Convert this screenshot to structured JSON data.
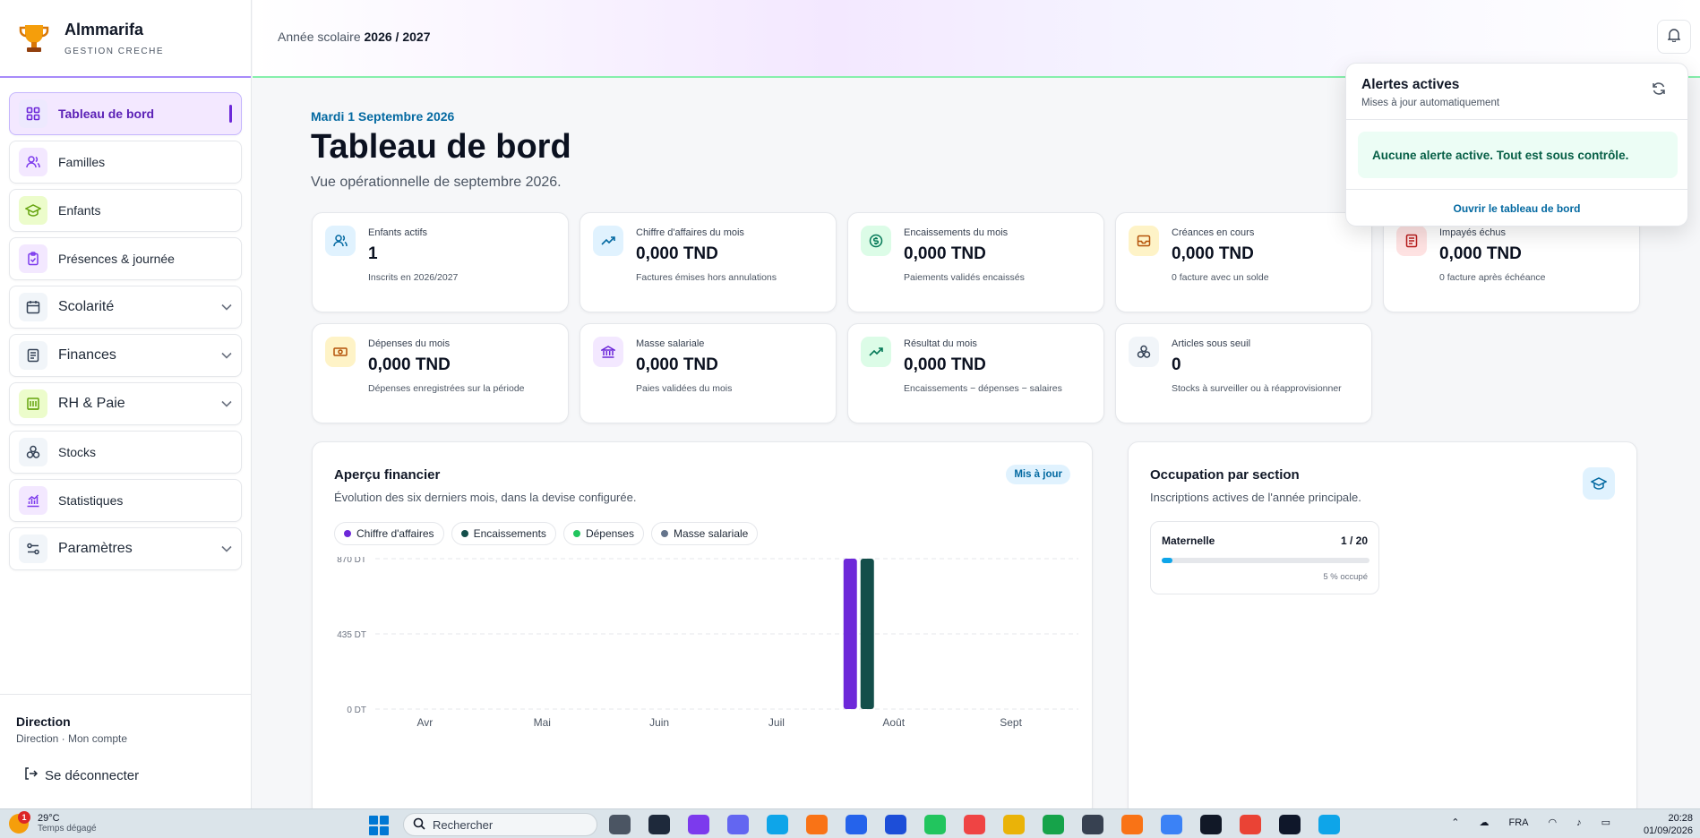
{
  "brand": {
    "name": "Almmarifa",
    "subtitle": "GESTION CRECHE"
  },
  "sidebar": {
    "items": [
      {
        "label": "Tableau de bord",
        "icon": "grid-icon",
        "active": true
      },
      {
        "label": "Familles",
        "icon": "users-icon"
      },
      {
        "label": "Enfants",
        "icon": "graduation-cap-icon"
      },
      {
        "label": "Présences & journée",
        "icon": "clipboard-check-icon"
      },
      {
        "label": "Scolarité",
        "icon": "calendar-icon",
        "expandable": true
      },
      {
        "label": "Finances",
        "icon": "receipt-icon",
        "expandable": true
      },
      {
        "label": "RH & Paie",
        "icon": "building-icon",
        "expandable": true
      },
      {
        "label": "Stocks",
        "icon": "boxes-icon"
      },
      {
        "label": "Statistiques",
        "icon": "bar-chart-icon"
      },
      {
        "label": "Paramètres",
        "icon": "sliders-icon",
        "expandable": true
      }
    ],
    "footer": {
      "role": "Direction",
      "account": "Direction · Mon compte",
      "logout": "Se déconnecter"
    }
  },
  "topbar": {
    "year_label": "Année scolaire",
    "year_value": "2026 / 2027"
  },
  "page": {
    "date": "Mardi 1 Septembre 2026",
    "title": "Tableau de bord",
    "subtitle": "Vue opérationnelle de septembre 2026."
  },
  "kpis": [
    {
      "label": "Enfants actifs",
      "value": "1",
      "caption": "Inscrits en 2026/2027",
      "icon": "users-icon"
    },
    {
      "label": "Chiffre d'affaires du mois",
      "value": "0,000 TND",
      "caption": "Factures émises hors annulations",
      "icon": "trending-up-icon"
    },
    {
      "label": "Encaissements du mois",
      "value": "0,000 TND",
      "caption": "Paiements validés encaissés",
      "icon": "dollar-circle-icon"
    },
    {
      "label": "Créances en cours",
      "value": "0,000 TND",
      "caption": "0 facture avec un solde",
      "icon": "inbox-icon"
    },
    {
      "label": "Impayés échus",
      "value": "0,000 TND",
      "caption": "0 facture après échéance",
      "icon": "document-icon"
    },
    {
      "label": "Dépenses du mois",
      "value": "0,000 TND",
      "caption": "Dépenses enregistrées sur la période",
      "icon": "banknote-icon"
    },
    {
      "label": "Masse salariale",
      "value": "0,000 TND",
      "caption": "Paies validées du mois",
      "icon": "bank-icon"
    },
    {
      "label": "Résultat du mois",
      "value": "0,000 TND",
      "caption": "Encaissements − dépenses − salaires",
      "icon": "trending-up-icon"
    },
    {
      "label": "Articles sous seuil",
      "value": "0",
      "caption": "Stocks à surveiller ou à réapprovisionner",
      "icon": "boxes-icon"
    }
  ],
  "finance_card": {
    "title": "Aperçu financier",
    "subtitle": "Évolution des six derniers mois, dans la devise configurée.",
    "badge": "Mis à jour"
  },
  "occupancy_card": {
    "title": "Occupation par section",
    "subtitle": "Inscriptions actives de l'année principale.",
    "section": {
      "name": "Maternelle",
      "count": "1 / 20",
      "percent_label": "5 % occupé",
      "percent": 5
    }
  },
  "alerts": {
    "title": "Alertes actives",
    "subtitle": "Mises à jour automatiquement",
    "message": "Aucune alerte active. Tout est sous contrôle.",
    "link": "Ouvrir le tableau de bord"
  },
  "chart_data": {
    "type": "bar",
    "categories": [
      "Avr",
      "Mai",
      "Juin",
      "Juil",
      "Août",
      "Sept"
    ],
    "series": [
      {
        "name": "Chiffre d'affaires",
        "color": "#6d28d9",
        "values": [
          0,
          0,
          0,
          0,
          870,
          0
        ]
      },
      {
        "name": "Encaissements",
        "color": "#134e4a",
        "values": [
          0,
          0,
          0,
          0,
          870,
          0
        ]
      },
      {
        "name": "Dépenses",
        "color": "#22c55e",
        "values": [
          0,
          0,
          0,
          0,
          0,
          0
        ]
      },
      {
        "name": "Masse salariale",
        "color": "#64748b",
        "values": [
          0,
          0,
          0,
          0,
          0,
          0
        ]
      }
    ],
    "yticks": [
      "870 DT",
      "435 DT",
      "0 DT"
    ],
    "ylim": [
      0,
      870
    ],
    "grid": true,
    "legend": "top-left"
  },
  "taskbar": {
    "weather_temp": "29°C",
    "weather_desc": "Temps dégagé",
    "notif_count": "1",
    "search_placeholder": "Rechercher",
    "language": "FRA",
    "time": "20:28",
    "date": "01/09/2026"
  }
}
